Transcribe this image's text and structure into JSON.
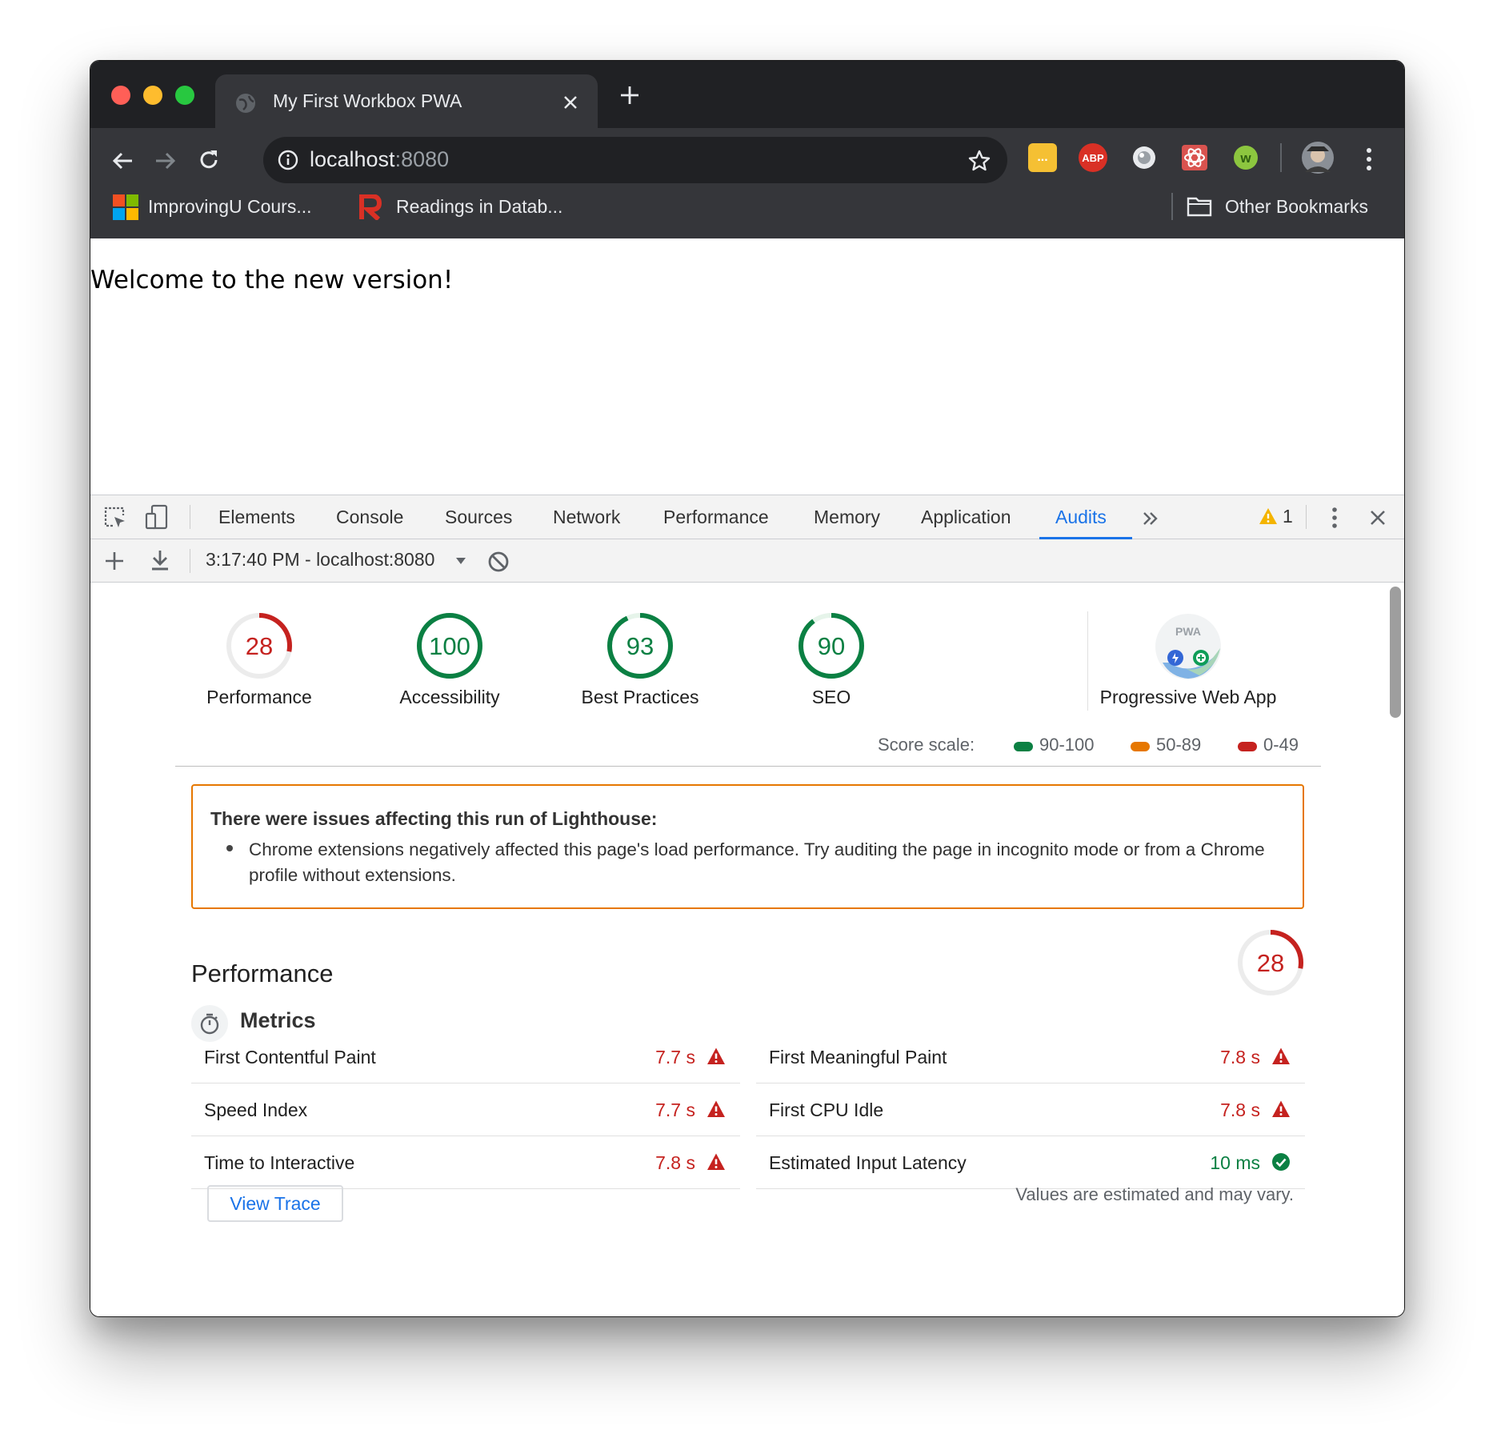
{
  "browser": {
    "tab_title": "My First Workbox PWA",
    "url_host": "localhost",
    "url_port": ":8080",
    "bookmarks": [
      {
        "label": "ImprovingU Cours..."
      },
      {
        "label": "Readings in Datab..."
      }
    ],
    "other_bookmarks": "Other Bookmarks",
    "extensions": [
      "...",
      "ABP"
    ]
  },
  "page": {
    "heading": "Welcome to the new version!"
  },
  "devtools": {
    "tabs": [
      "Elements",
      "Console",
      "Sources",
      "Network",
      "Performance",
      "Memory",
      "Application",
      "Audits"
    ],
    "active_tab": "Audits",
    "warning_count": "1",
    "report_selector": "3:17:40 PM - localhost:8080"
  },
  "lighthouse": {
    "categories": [
      {
        "label": "Performance",
        "score": "28",
        "color": "#c5221f"
      },
      {
        "label": "Accessibility",
        "score": "100",
        "color": "#0b8043"
      },
      {
        "label": "Best Practices",
        "score": "93",
        "color": "#0b8043"
      },
      {
        "label": "SEO",
        "score": "90",
        "color": "#0b8043"
      }
    ],
    "pwa_label": "Progressive Web App",
    "pwa_badge": "PWA",
    "score_scale": {
      "label": "Score scale:",
      "ranges": [
        {
          "label": "90-100",
          "color": "#0b8043"
        },
        {
          "label": "50-89",
          "color": "#e67700"
        },
        {
          "label": "0-49",
          "color": "#c5221f"
        }
      ]
    },
    "warning": {
      "title": "There were issues affecting this run of Lighthouse:",
      "items": [
        "Chrome extensions negatively affected this page's load performance. Try auditing the page in incognito mode or from a Chrome profile without extensions."
      ]
    },
    "performance": {
      "title": "Performance",
      "score": "28",
      "metrics_title": "Metrics",
      "metrics": [
        {
          "name": "First Contentful Paint",
          "value": "7.7 s",
          "status": "fail"
        },
        {
          "name": "First Meaningful Paint",
          "value": "7.8 s",
          "status": "fail"
        },
        {
          "name": "Speed Index",
          "value": "7.7 s",
          "status": "fail"
        },
        {
          "name": "First CPU Idle",
          "value": "7.8 s",
          "status": "fail"
        },
        {
          "name": "Time to Interactive",
          "value": "7.8 s",
          "status": "fail"
        },
        {
          "name": "Estimated Input Latency",
          "value": "10 ms",
          "status": "pass"
        }
      ],
      "view_trace": "View Trace",
      "disclaimer": "Values are estimated and may vary."
    }
  }
}
